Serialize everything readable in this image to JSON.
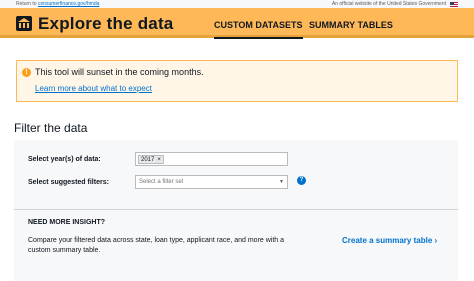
{
  "topbar": {
    "return_prefix": "Return to",
    "return_link": "consumerfinance.gov/hmda",
    "official_text": "An official website of the United States Government"
  },
  "header": {
    "title": "Explore the data",
    "nav": [
      {
        "label": "CUSTOM DATASETS",
        "active": true
      },
      {
        "label": "SUMMARY TABLES",
        "active": false
      }
    ]
  },
  "alert": {
    "icon": "!",
    "message": "This tool will sunset in the coming months.",
    "link": "Learn more about what to expect"
  },
  "filter": {
    "title": "Filter the data",
    "year_label": "Select year(s) of data:",
    "selected_year": "2017",
    "remove_glyph": "×",
    "filters_label": "Select suggested filters:",
    "filters_placeholder": "Select a filter set",
    "help_glyph": "?"
  },
  "insight": {
    "title": "NEED MORE INSIGHT?",
    "text": "Compare your filtered data across state, loan type, applicant race, and more with a custom summary table.",
    "link": "Create a summary table"
  },
  "icons": {
    "alert": "warning-icon",
    "help": "question-icon",
    "caret": "chevron-down-icon",
    "link_arrow": "chevron-right-icon"
  },
  "colors": {
    "header": "#ffb858",
    "link": "#0072ce",
    "panel": "#f7f8f9",
    "alert_bg": "#fff6e8"
  }
}
